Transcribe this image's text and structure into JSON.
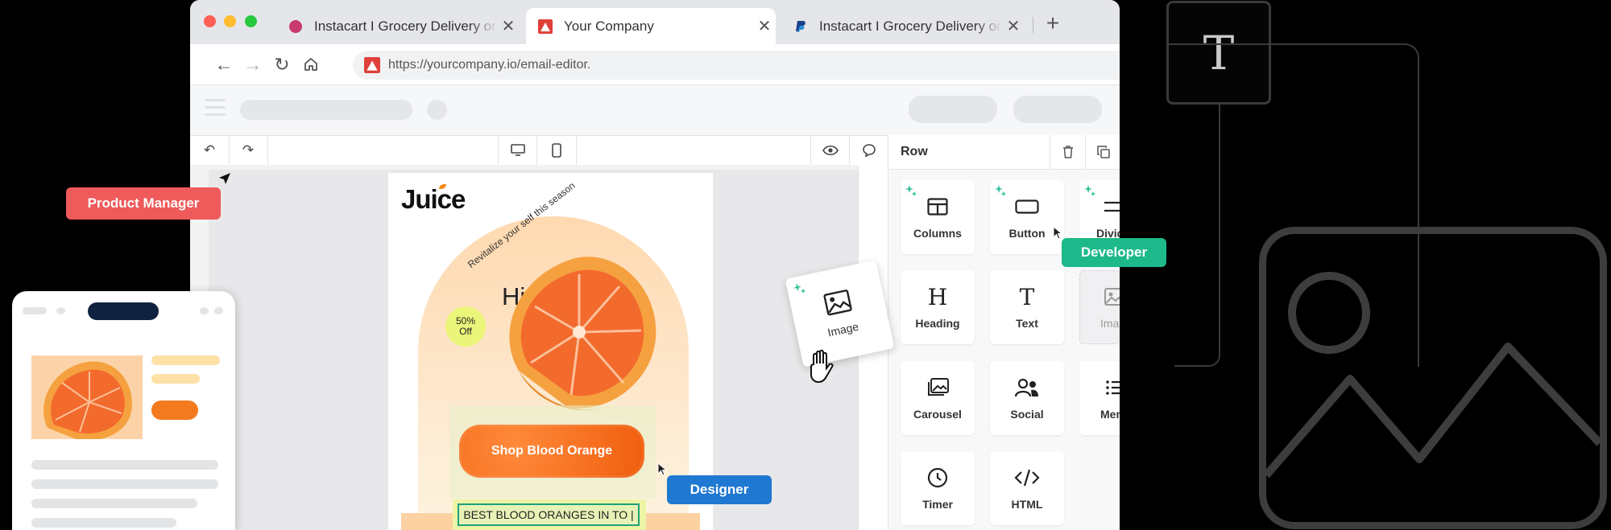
{
  "browser": {
    "tabs": [
      {
        "label": "Instacart I Grocery Delivery or Pickup",
        "icon": "instacart-favicon-icon",
        "active": false
      },
      {
        "label": "Your Company",
        "icon": "company-favicon-icon",
        "active": true
      },
      {
        "label": "Instacart I Grocery Delivery or Pickup",
        "icon": "paypal-favicon-icon",
        "active": false
      }
    ],
    "close_glyph": "✕",
    "new_tab_glyph": "+",
    "url": "https://yourcompany.io/email-editor."
  },
  "editor": {
    "panel": {
      "title": "Row",
      "blocks": [
        {
          "label": "Columns",
          "icon": "columns-icon",
          "ai": true
        },
        {
          "label": "Button",
          "icon": "button-icon",
          "ai": true
        },
        {
          "label": "Divider",
          "icon": "divider-icon",
          "ai": true
        },
        {
          "label": "Heading",
          "icon": "heading-icon",
          "ai": false
        },
        {
          "label": "Text",
          "icon": "text-icon",
          "ai": false
        },
        {
          "label": "Image",
          "icon": "image-icon",
          "ai": false,
          "placeholder": true
        },
        {
          "label": "Carousel",
          "icon": "carousel-icon",
          "ai": false
        },
        {
          "label": "Social",
          "icon": "social-icon",
          "ai": false
        },
        {
          "label": "Menu",
          "icon": "menu-icon",
          "ai": false
        },
        {
          "label": "Timer",
          "icon": "timer-icon",
          "ai": false
        },
        {
          "label": "HTML",
          "icon": "html-icon",
          "ai": false
        }
      ]
    },
    "dragging_block": {
      "label": "Image",
      "icon": "image-icon"
    }
  },
  "email": {
    "logo": "Juice",
    "arc_text": "Revitalize your self this season",
    "headline": "Hit",
    "badge": {
      "line1": "50%",
      "line2": "Off"
    },
    "cta": "Shop Blood Orange",
    "text_block": "BEST BLOOD ORANGES IN TO |"
  },
  "collaborators": [
    {
      "label": "Product Manager",
      "color": "#ef5a5a"
    },
    {
      "label": "Developer",
      "color": "#1db98a"
    },
    {
      "label": "Designer",
      "color": "#1f78d1"
    }
  ],
  "colors": {
    "cta": "#f05d0e",
    "accent_orange": "#f47a20",
    "selection": "#20a07a"
  }
}
